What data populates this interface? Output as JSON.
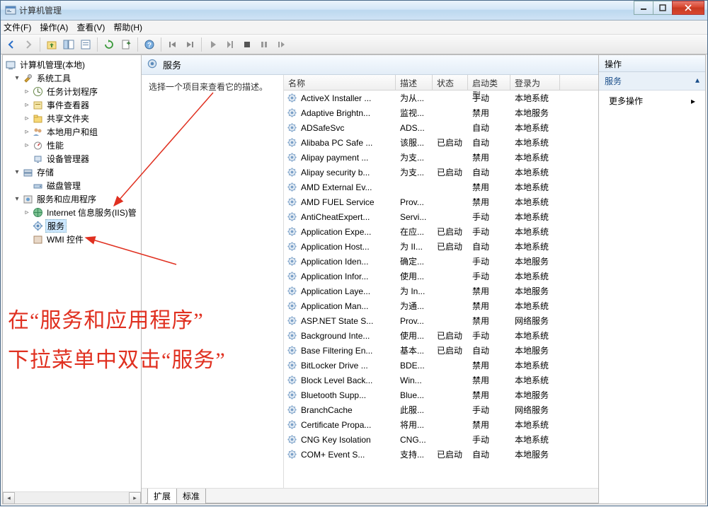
{
  "window": {
    "title": "计算机管理"
  },
  "menu": {
    "file": "文件(F)",
    "action": "操作(A)",
    "view": "查看(V)",
    "help": "帮助(H)"
  },
  "tree": {
    "root": "计算机管理(本地)",
    "sys_tools": "系统工具",
    "task_sched": "任务计划程序",
    "event_viewer": "事件查看器",
    "shared_folders": "共享文件夹",
    "local_users": "本地用户和组",
    "performance": "性能",
    "device_mgr": "设备管理器",
    "storage": "存储",
    "disk_mgmt": "磁盘管理",
    "svc_apps": "服务和应用程序",
    "iis": "Internet 信息服务(IIS)管",
    "services": "服务",
    "wmi": "WMI 控件"
  },
  "services_header": "服务",
  "desc_hint": "选择一个项目来查看它的描述。",
  "columns": {
    "name": "名称",
    "desc": "描述",
    "status": "状态",
    "startup": "启动类型",
    "logon": "登录为"
  },
  "rows": [
    {
      "name": "ActiveX Installer ...",
      "desc": "为从...",
      "status": "",
      "startup": "手动",
      "logon": "本地系统"
    },
    {
      "name": "Adaptive Brightn...",
      "desc": "监视...",
      "status": "",
      "startup": "禁用",
      "logon": "本地服务"
    },
    {
      "name": "ADSafeSvc",
      "desc": "ADS...",
      "status": "",
      "startup": "自动",
      "logon": "本地系统"
    },
    {
      "name": "Alibaba PC Safe ...",
      "desc": "该服...",
      "status": "已启动",
      "startup": "自动",
      "logon": "本地系统"
    },
    {
      "name": "Alipay payment ...",
      "desc": "为支...",
      "status": "",
      "startup": "禁用",
      "logon": "本地系统"
    },
    {
      "name": "Alipay security b...",
      "desc": "为支...",
      "status": "已启动",
      "startup": "自动",
      "logon": "本地系统"
    },
    {
      "name": "AMD External Ev...",
      "desc": "",
      "status": "",
      "startup": "禁用",
      "logon": "本地系统"
    },
    {
      "name": "AMD FUEL Service",
      "desc": "Prov...",
      "status": "",
      "startup": "禁用",
      "logon": "本地系统"
    },
    {
      "name": "AntiCheatExpert...",
      "desc": "Servi...",
      "status": "",
      "startup": "手动",
      "logon": "本地系统"
    },
    {
      "name": "Application Expe...",
      "desc": "在应...",
      "status": "已启动",
      "startup": "手动",
      "logon": "本地系统"
    },
    {
      "name": "Application Host...",
      "desc": "为 II...",
      "status": "已启动",
      "startup": "自动",
      "logon": "本地系统"
    },
    {
      "name": "Application Iden...",
      "desc": "确定...",
      "status": "",
      "startup": "手动",
      "logon": "本地服务"
    },
    {
      "name": "Application Infor...",
      "desc": "使用...",
      "status": "",
      "startup": "手动",
      "logon": "本地系统"
    },
    {
      "name": "Application Laye...",
      "desc": "为 In...",
      "status": "",
      "startup": "禁用",
      "logon": "本地服务"
    },
    {
      "name": "Application Man...",
      "desc": "为通...",
      "status": "",
      "startup": "禁用",
      "logon": "本地系统"
    },
    {
      "name": "ASP.NET State S...",
      "desc": "Prov...",
      "status": "",
      "startup": "禁用",
      "logon": "网络服务"
    },
    {
      "name": "Background Inte...",
      "desc": "使用...",
      "status": "已启动",
      "startup": "手动",
      "logon": "本地系统"
    },
    {
      "name": "Base Filtering En...",
      "desc": "基本...",
      "status": "已启动",
      "startup": "自动",
      "logon": "本地服务"
    },
    {
      "name": "BitLocker Drive ...",
      "desc": "BDE...",
      "status": "",
      "startup": "禁用",
      "logon": "本地系统"
    },
    {
      "name": "Block Level Back...",
      "desc": "Win...",
      "status": "",
      "startup": "禁用",
      "logon": "本地系统"
    },
    {
      "name": "Bluetooth Supp...",
      "desc": "Blue...",
      "status": "",
      "startup": "禁用",
      "logon": "本地服务"
    },
    {
      "name": "BranchCache",
      "desc": "此服...",
      "status": "",
      "startup": "手动",
      "logon": "网络服务"
    },
    {
      "name": "Certificate Propa...",
      "desc": "将用...",
      "status": "",
      "startup": "禁用",
      "logon": "本地系统"
    },
    {
      "name": "CNG Key Isolation",
      "desc": "CNG...",
      "status": "",
      "startup": "手动",
      "logon": "本地系统"
    },
    {
      "name": "COM+ Event S...",
      "desc": "支持...",
      "status": "已启动",
      "startup": "自动",
      "logon": "本地服务"
    }
  ],
  "tabs": {
    "extended": "扩展",
    "standard": "标准"
  },
  "actions": {
    "header": "操作",
    "title": "服务",
    "more": "更多操作"
  },
  "annotation": {
    "line1": "在“服务和应用程序”",
    "line2": "下拉菜单中双击“服务”"
  }
}
